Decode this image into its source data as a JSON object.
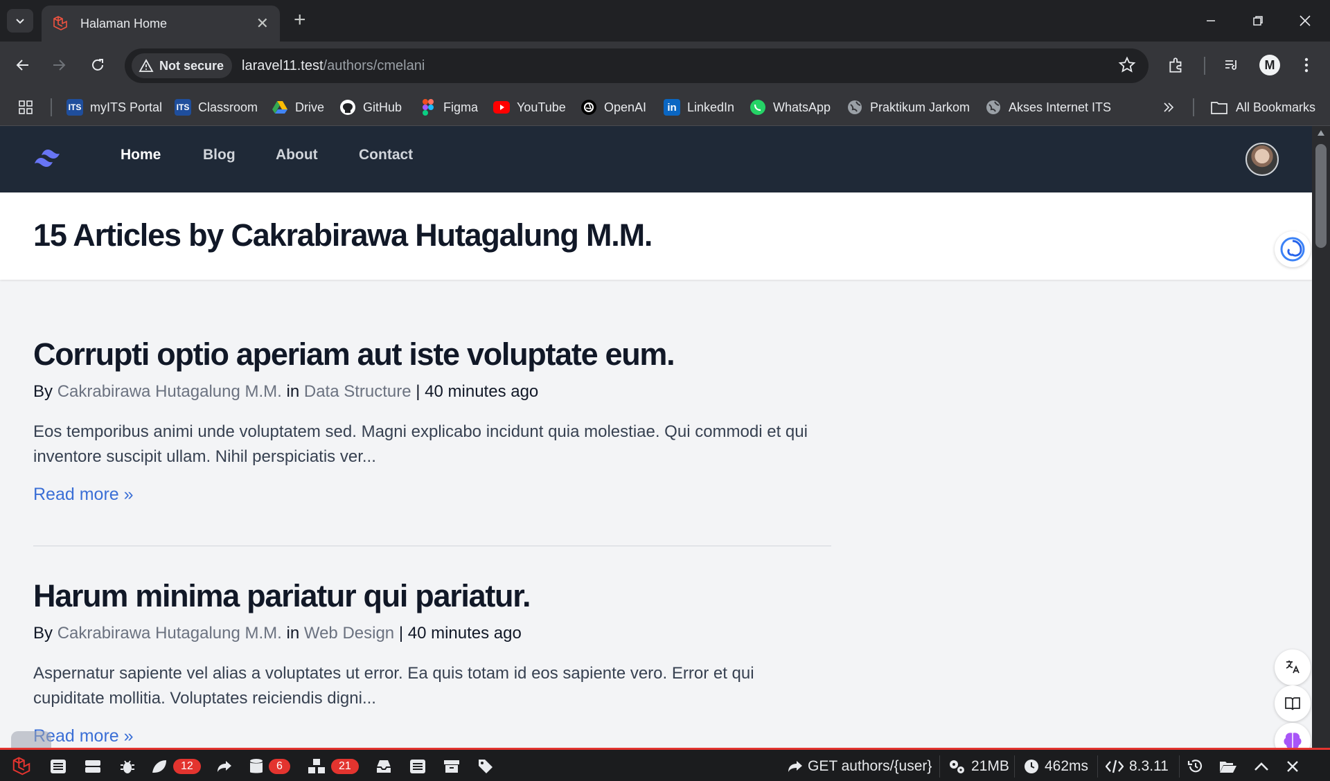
{
  "browser": {
    "tab_title": "Halaman Home",
    "url_host": "laravel11.test",
    "url_path": "/authors/cmelani",
    "security_chip": "Not secure",
    "profile_initial": "M"
  },
  "bookmarks": {
    "items": [
      {
        "label": "myITS Portal",
        "icon": "its-icon",
        "color": "#1f4e9c"
      },
      {
        "label": "Classroom",
        "icon": "its-icon",
        "color": "#1f4e9c"
      },
      {
        "label": "Drive",
        "icon": "drive-icon",
        "color": "#34a853"
      },
      {
        "label": "GitHub",
        "icon": "github-icon",
        "color": "#ffffff"
      },
      {
        "label": "Figma",
        "icon": "figma-icon",
        "color": "#f24e1e"
      },
      {
        "label": "YouTube",
        "icon": "youtube-icon",
        "color": "#ff0000"
      },
      {
        "label": "OpenAI",
        "icon": "openai-icon",
        "color": "#ffffff"
      },
      {
        "label": "LinkedIn",
        "icon": "linkedin-icon",
        "color": "#0a66c2"
      },
      {
        "label": "WhatsApp",
        "icon": "whatsapp-icon",
        "color": "#25d366"
      },
      {
        "label": "Praktikum Jarkom",
        "icon": "globe-icon",
        "color": "#9aa0a6"
      },
      {
        "label": "Akses Internet ITS",
        "icon": "globe-icon",
        "color": "#9aa0a6"
      }
    ],
    "all_bookmarks": "All Bookmarks"
  },
  "site": {
    "nav": [
      "Home",
      "Blog",
      "About",
      "Contact"
    ],
    "page_title": "15 Articles by Cakrabirawa Hutagalung M.M."
  },
  "articles": [
    {
      "title": "Corrupti optio aperiam aut iste voluptate eum.",
      "by": "By",
      "author": "Cakrabirawa Hutagalung M.M.",
      "in": "in",
      "category": "Data Structure",
      "time": "40 minutes ago",
      "excerpt": "Eos temporibus animi unde voluptatem sed. Magni explicabo incidunt quia molestiae. Qui commodi et qui inventore suscipit ullam. Nihil perspiciatis ver...",
      "read_more": "Read more »"
    },
    {
      "title": "Harum minima pariatur qui pariatur.",
      "by": "By",
      "author": "Cakrabirawa Hutagalung M.M.",
      "in": "in",
      "category": "Web Design",
      "time": "40 minutes ago",
      "excerpt": "Aspernatur sapiente vel alias a voluptates ut error. Ea quis totam id eos sapiente vero. Error et qui cupiditate mollitia. Voluptates reiciendis digni...",
      "read_more": "Read more »"
    }
  ],
  "debugbar": {
    "views_count": "12",
    "queries_count": "6",
    "models_count": "21",
    "route": "GET authors/{user}",
    "memory": "21MB",
    "time": "462ms",
    "php_version": "8.3.11"
  },
  "colors": {
    "site_nav_bg": "#1f2937",
    "link_blue": "#3b6fd6",
    "debug_red": "#e3342f"
  }
}
